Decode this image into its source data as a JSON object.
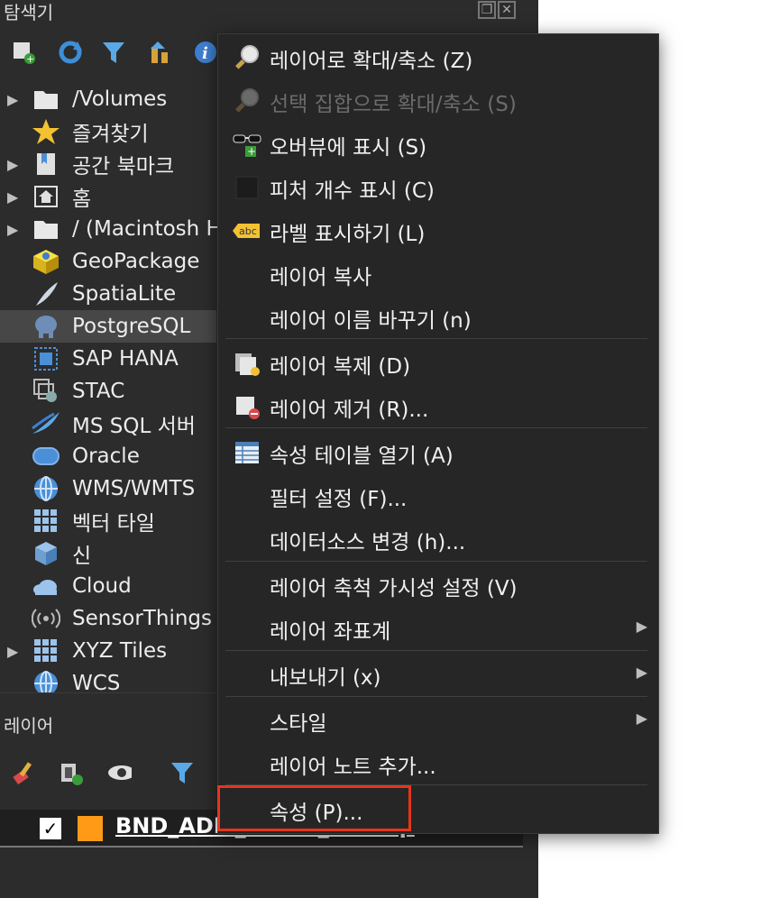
{
  "browser_panel": {
    "title": "탐색기",
    "dock_buttons": [
      "float-icon",
      "close-icon"
    ],
    "toolbar_icons": [
      "add-layer-icon",
      "refresh-icon",
      "filter-icon",
      "collapse-icon",
      "info-icon"
    ],
    "items": [
      {
        "label": "/Volumes",
        "icon": "folder-icon",
        "expandable": true
      },
      {
        "label": "즐겨찾기",
        "icon": "star-icon",
        "expandable": false
      },
      {
        "label": "공간 북마크",
        "icon": "bookmark-icon",
        "expandable": true
      },
      {
        "label": "홈",
        "icon": "home-icon",
        "expandable": true
      },
      {
        "label": "/ (Macintosh HD)",
        "icon": "folder-icon",
        "expandable": true
      },
      {
        "label": "GeoPackage",
        "icon": "geopackage-icon",
        "expandable": false
      },
      {
        "label": "SpatiaLite",
        "icon": "feather-icon",
        "expandable": false
      },
      {
        "label": "PostgreSQL",
        "icon": "elephant-icon",
        "expandable": false,
        "selected": true
      },
      {
        "label": "SAP HANA",
        "icon": "hana-icon",
        "expandable": false
      },
      {
        "label": "STAC",
        "icon": "stac-icon",
        "expandable": false
      },
      {
        "label": "MS SQL 서버",
        "icon": "mssql-icon",
        "expandable": false
      },
      {
        "label": "Oracle",
        "icon": "oracle-icon",
        "expandable": false
      },
      {
        "label": "WMS/WMTS",
        "icon": "globe-icon",
        "expandable": false
      },
      {
        "label": "벡터 타일",
        "icon": "grid-icon",
        "expandable": false
      },
      {
        "label": "신",
        "icon": "cube-icon",
        "expandable": false
      },
      {
        "label": "Cloud",
        "icon": "cloud-icon",
        "expandable": false
      },
      {
        "label": "SensorThings",
        "icon": "sensor-icon",
        "expandable": false
      },
      {
        "label": "XYZ Tiles",
        "icon": "grid-icon",
        "expandable": true
      },
      {
        "label": "WCS",
        "icon": "globe-icon",
        "expandable": false
      }
    ]
  },
  "layers_panel": {
    "title": "레이어",
    "toolbar_icons": [
      "style-brush-icon",
      "add-group-icon",
      "eye-icon",
      "filter-icon"
    ],
    "layer": {
      "name": "BND_ADM_DONG_PG.shp",
      "checked": "✓",
      "color": "#ff9a17"
    }
  },
  "context_menu": {
    "items": [
      {
        "label": "레이어로 확대/축소 (Z)",
        "icon": "zoom-icon",
        "disabled": false,
        "submenu": false
      },
      {
        "label": "선택 집합으로 확대/축소 (S)",
        "icon": "zoom-icon",
        "disabled": true,
        "submenu": false
      },
      {
        "label": "오버뷰에 표시 (S)",
        "icon": "glasses-icon",
        "disabled": false,
        "submenu": false
      },
      {
        "label": "피처 개수 표시 (C)",
        "icon": "checkbox-icon",
        "disabled": false,
        "submenu": false
      },
      {
        "label": "라벨 표시하기 (L)",
        "icon": "label-abc-icon",
        "disabled": false,
        "submenu": false
      },
      {
        "label": "레이어 복사",
        "icon": "",
        "disabled": false,
        "submenu": false
      },
      {
        "label": "레이어 이름 바꾸기 (n)",
        "icon": "",
        "disabled": false,
        "submenu": false
      },
      {
        "label": "레이어 복제 (D)",
        "icon": "duplicate-icon",
        "disabled": false,
        "submenu": false
      },
      {
        "label": "레이어 제거 (R)...",
        "icon": "remove-layer-icon",
        "disabled": false,
        "submenu": false
      },
      {
        "label": "속성 테이블 열기 (A)",
        "icon": "table-icon",
        "disabled": false,
        "submenu": false
      },
      {
        "label": "필터 설정 (F)...",
        "icon": "",
        "disabled": false,
        "submenu": false
      },
      {
        "label": "데이터소스 변경 (h)...",
        "icon": "",
        "disabled": false,
        "submenu": false
      },
      {
        "label": "레이어 축척 가시성 설정 (V)",
        "icon": "",
        "disabled": false,
        "submenu": false
      },
      {
        "label": "레이어 좌표계",
        "icon": "",
        "disabled": false,
        "submenu": true
      },
      {
        "label": "내보내기 (x)",
        "icon": "",
        "disabled": false,
        "submenu": true
      },
      {
        "label": "스타일",
        "icon": "",
        "disabled": false,
        "submenu": true
      },
      {
        "label": "레이어 노트 추가...",
        "icon": "",
        "disabled": false,
        "submenu": false
      },
      {
        "label": "속성 (P)...",
        "icon": "",
        "disabled": false,
        "submenu": false,
        "highlighted": true
      }
    ]
  },
  "colors": {
    "highlight_border": "#e8341c",
    "layer_swatch": "#ff9a17"
  }
}
